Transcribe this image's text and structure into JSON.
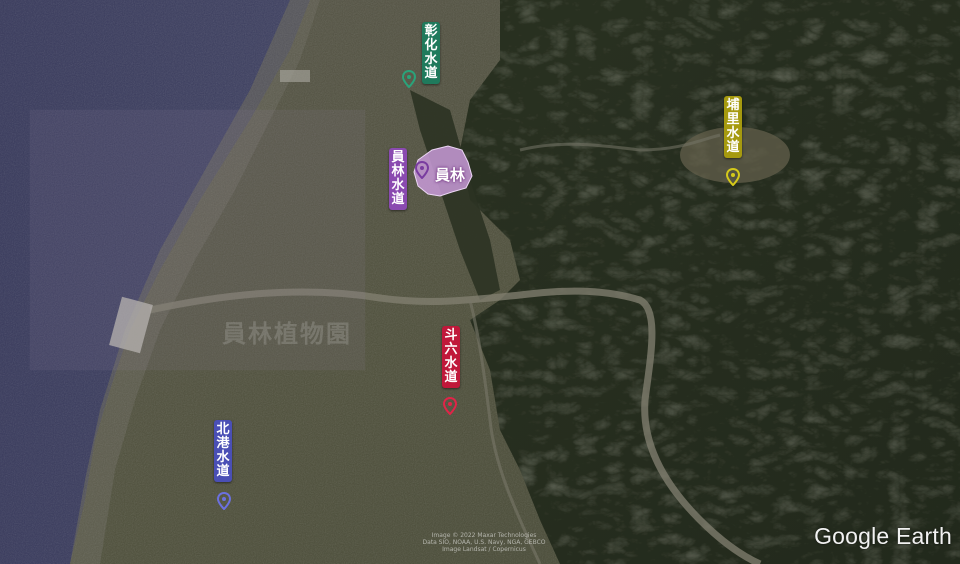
{
  "app": {
    "logo_text": "Google Earth"
  },
  "imagery_credits": {
    "line1": "Image © 2022 Maxar Technologies",
    "line2": "Data SIO, NOAA, U.S. Navy, NGA, GEBCO",
    "line3": "Image Landsat / Copernicus"
  },
  "region": {
    "name": "員林",
    "fill_color": "#c89ad8"
  },
  "watermark": {
    "text": "員林植物園"
  },
  "waterways": [
    {
      "id": "changhua",
      "name": "彰化水道",
      "color": "#1f7a5c"
    },
    {
      "id": "yuanlin",
      "name": "員林水道",
      "color": "#8a4ab0"
    },
    {
      "id": "puli",
      "name": "埔里水道",
      "color": "#a69a0f"
    },
    {
      "id": "douliu",
      "name": "斗六水道",
      "color": "#c0183a"
    },
    {
      "id": "beigang",
      "name": "北港水道",
      "color": "#4a4fb5"
    }
  ]
}
